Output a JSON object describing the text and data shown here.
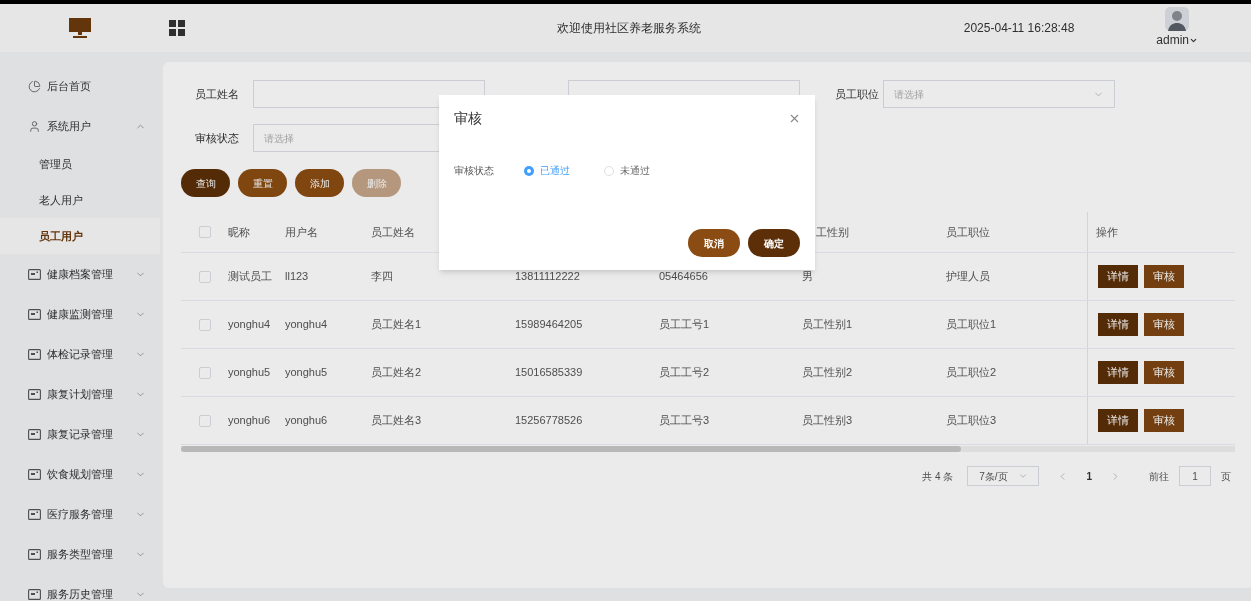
{
  "header": {
    "title": "欢迎使用社区养老服务系统",
    "datetime": "2025-04-11 16:28:48",
    "user": "admin"
  },
  "sidebar": {
    "items": [
      {
        "label": "后台首页",
        "kind": "link"
      },
      {
        "label": "系统用户",
        "kind": "group",
        "expanded": true,
        "children": [
          {
            "label": "管理员",
            "selected": false
          },
          {
            "label": "老人用户",
            "selected": false
          },
          {
            "label": "员工用户",
            "selected": true
          }
        ]
      },
      {
        "label": "健康档案管理",
        "kind": "group",
        "expanded": false
      },
      {
        "label": "健康监测管理",
        "kind": "group",
        "expanded": false
      },
      {
        "label": "体检记录管理",
        "kind": "group",
        "expanded": false
      },
      {
        "label": "康复计划管理",
        "kind": "group",
        "expanded": false
      },
      {
        "label": "康复记录管理",
        "kind": "group",
        "expanded": false
      },
      {
        "label": "饮食规划管理",
        "kind": "group",
        "expanded": false
      },
      {
        "label": "医疗服务管理",
        "kind": "group",
        "expanded": false
      },
      {
        "label": "服务类型管理",
        "kind": "group",
        "expanded": false
      },
      {
        "label": "服务历史管理",
        "kind": "group",
        "expanded": false
      }
    ]
  },
  "filters": [
    {
      "label": "员工姓名",
      "kind": "text"
    },
    {
      "kind": "text"
    },
    {
      "label": "员工职位",
      "kind": "select",
      "placeholder": "请选择"
    },
    {
      "label": "审核状态",
      "kind": "select",
      "placeholder": "请选择"
    }
  ],
  "buttons": [
    {
      "label": "查询",
      "kind": "dark",
      "disabled": false
    },
    {
      "label": "重置",
      "kind": "medium",
      "disabled": false
    },
    {
      "label": "添加",
      "kind": "medium",
      "disabled": false
    },
    {
      "label": "删除",
      "kind": "medium",
      "disabled": true
    }
  ],
  "table": {
    "all_checked": false,
    "columns": [
      {
        "label": "昵称"
      },
      {
        "label": "用户名"
      },
      {
        "label": "员工姓名"
      },
      {},
      {},
      {
        "label": "工性别",
        "cut": true
      },
      {
        "label": "员工职位"
      },
      {
        "label": "操作"
      }
    ],
    "rows": [
      {
        "checked": false,
        "cells": [
          "测试员工",
          "ll123",
          "李四",
          "13811112222",
          "05464656",
          "男",
          "护理人员"
        ],
        "actions": [
          "详情",
          "审核"
        ]
      },
      {
        "checked": false,
        "cells": [
          "yonghu4",
          "yonghu4",
          "员工姓名1",
          "15989464205",
          "员工工号1",
          "员工性别1",
          "员工职位1"
        ],
        "actions": [
          "详情",
          "审核"
        ]
      },
      {
        "checked": false,
        "cells": [
          "yonghu5",
          "yonghu5",
          "员工姓名2",
          "15016585339",
          "员工工号2",
          "员工性别2",
          "员工职位2"
        ],
        "actions": [
          "详情",
          "审核"
        ]
      },
      {
        "checked": false,
        "cells": [
          "yonghu6",
          "yonghu6",
          "员工姓名3",
          "15256778526",
          "员工工号3",
          "员工性别3",
          "员工职位3"
        ],
        "actions": [
          "详情",
          "审核"
        ]
      }
    ]
  },
  "pagination": {
    "total": "共 4 条",
    "page_size": "7条/页",
    "current": "1",
    "goto_label": "前往",
    "goto_value": "1",
    "page_unit": "页"
  },
  "dialog": {
    "title": "审核",
    "field_label": "审核状态",
    "options": [
      {
        "label": "已通过",
        "selected": true
      },
      {
        "label": "未通过",
        "selected": false
      }
    ],
    "buttons": [
      {
        "label": "取消",
        "kind": "medium"
      },
      {
        "label": "确定",
        "kind": "dark"
      }
    ]
  }
}
